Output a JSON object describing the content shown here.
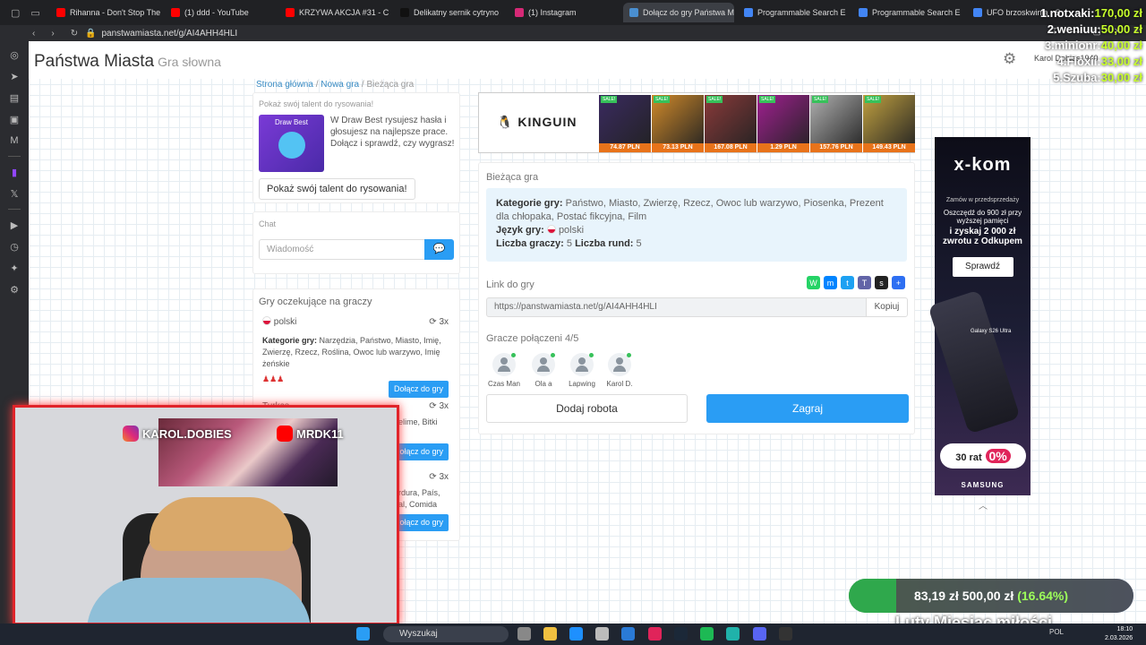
{
  "browser": {
    "tabs": [
      {
        "title": "Rihanna - Don't Stop The",
        "color": "#ff0000"
      },
      {
        "title": "(1) ddd - YouTube",
        "color": "#ff0000"
      },
      {
        "title": "KRZYWA AKCJA #31 - C",
        "color": "#ff0000"
      },
      {
        "title": "Delikatny sernik cytryno",
        "color": "#111111"
      },
      {
        "title": "(1) Instagram",
        "color": "#d62976"
      },
      {
        "title": "Dołącz do gry Państwa M",
        "color": "#4a8fd0",
        "active": true
      },
      {
        "title": "Programmable Search E",
        "color": "#4285f4"
      },
      {
        "title": "Programmable Search E",
        "color": "#4285f4"
      },
      {
        "title": "UFO brzoskwinia - S",
        "color": "#4285f4"
      }
    ],
    "url": "panstwamiasta.net/g/AI4AHH4HLI"
  },
  "site": {
    "logo": "Państwa Miasta",
    "tagline": "Gra słowna",
    "user": "Karol Dobies1940"
  },
  "breadcrumb": {
    "home": "Strona główna",
    "new_game": "Nowa gra",
    "current": "Bieżąca gra"
  },
  "promo": {
    "heading": "Pokaż swój talent do rysowania!",
    "image_title": "Draw Best",
    "text": "W Draw Best rysujesz hasła i głosujesz na najlepsze prace. Dołącz i sprawdź, czy wygrasz!",
    "button": "Pokaż swój talent do rysowania!"
  },
  "chat": {
    "title": "Chat",
    "placeholder": "Wiadomość"
  },
  "lobby": {
    "title": "Gry oczekujące na graczy",
    "games": [
      {
        "language": "polski",
        "rounds": "3x",
        "categories_label": "Kategorie gry:",
        "categories": "Narzędzia, Państwo, Miasto, Imię, Zwierzę, Rzecz, Roślina, Owoc lub warzywo, Imię żeńskie",
        "join": "Dołącz do gry"
      },
      {
        "language": "Turkce",
        "rounds": "3x",
        "categories": "elime, Bitki",
        "join": "Dołącz do gry"
      },
      {
        "language": "",
        "rounds": "3x",
        "categories": "rdura, País, al, Comida",
        "join": "Dołącz do gry"
      }
    ]
  },
  "kinguin": {
    "brand": "KINGUIN",
    "deals": [
      {
        "price": "74.87 PLN",
        "color": "#3a2a60"
      },
      {
        "price": "73.13 PLN",
        "color": "#d08a2a"
      },
      {
        "price": "167.08 PLN",
        "color": "#8a3a3a"
      },
      {
        "price": "1.29 PLN",
        "color": "#a02090"
      },
      {
        "price": "157.76 PLN",
        "color": "#b0b0b0"
      },
      {
        "price": "149.43 PLN",
        "color": "#c0a040"
      }
    ],
    "sale_label": "SALE!"
  },
  "current_game": {
    "title": "Bieżąca gra",
    "categories_label": "Kategorie gry:",
    "categories": "Państwo, Miasto, Zwierzę, Rzecz, Owoc lub warzywo, Piosenka, Prezent dla chłopaka, Postać fikcyjna, Film",
    "language_label": "Język gry:",
    "language": "polski",
    "players_label": "Liczba graczy:",
    "players_count": "5",
    "rounds_label": "Liczba rund:",
    "rounds_count": "5",
    "link_label": "Link do gry",
    "link": "https://panstwamiasta.net/g/AI4AHH4HLI",
    "copy_button": "Kopiuj",
    "connected_label": "Gracze połączeni 4/5",
    "players": [
      "Czas Man",
      "Ola a",
      "Lapwing",
      "Karol D."
    ],
    "add_bot_button": "Dodaj robota",
    "play_button": "Zagraj",
    "share_colors": [
      "#25d366",
      "#0084ff",
      "#1da1f2",
      "#6264a7",
      "#222222",
      "#2e6ff2"
    ]
  },
  "xkom": {
    "brand": "x-kom",
    "line1": "Zamów w przedsprzedaży",
    "line2": "Oszczędź do 900 zł przy wyższej pamięci",
    "line3": "i zyskaj 2 000 zł zwrotu z Odkupem",
    "button": "Sprawdź",
    "phone": "Galaxy S26 Ultra",
    "installments": "30 rat",
    "zero": "0%",
    "samsung": "SAMSUNG"
  },
  "stream": {
    "instagram": "KAROL.DOBIES",
    "youtube": "MRDK11",
    "ranking": [
      {
        "name": "1.notxaki:",
        "amount": "170,00 zł"
      },
      {
        "name": "2.weniuu:",
        "amount": "50,00 zł"
      },
      {
        "name": "3.minionr:",
        "amount": "40,00 zł"
      },
      {
        "name": "4.Floxii:",
        "amount": "33,00 zł"
      },
      {
        "name": "5.Szuba:",
        "amount": "30,00 zł"
      }
    ],
    "goal_current": "83,19 zł",
    "goal_target": "500,00 zł",
    "goal_percent": "(16.64%)",
    "goal_fraction": 0.1664,
    "goal_title": "Luty Miesiąc miłości"
  },
  "taskbar": {
    "search": "Wyszukaj",
    "lang": "POL",
    "time": "18:10",
    "date": "2.03.2026"
  }
}
